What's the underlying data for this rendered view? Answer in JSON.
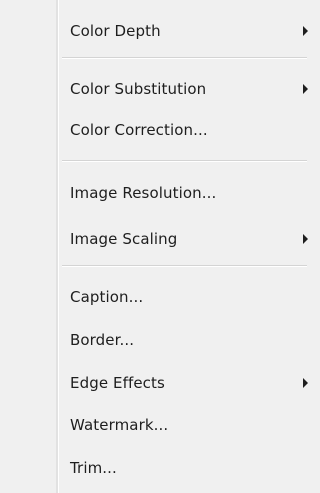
{
  "menu": {
    "items": [
      {
        "label": "Color Depth",
        "submenu": true
      },
      {
        "label": "Color Substitution",
        "submenu": true
      },
      {
        "label": "Color Correction...",
        "submenu": false
      },
      {
        "label": "Image Resolution...",
        "submenu": false
      },
      {
        "label": "Image Scaling",
        "submenu": true
      },
      {
        "label": "Caption...",
        "submenu": false
      },
      {
        "label": "Border...",
        "submenu": false
      },
      {
        "label": "Edge Effects",
        "submenu": true
      },
      {
        "label": "Watermark...",
        "submenu": false
      },
      {
        "label": "Trim...",
        "submenu": false
      }
    ]
  }
}
